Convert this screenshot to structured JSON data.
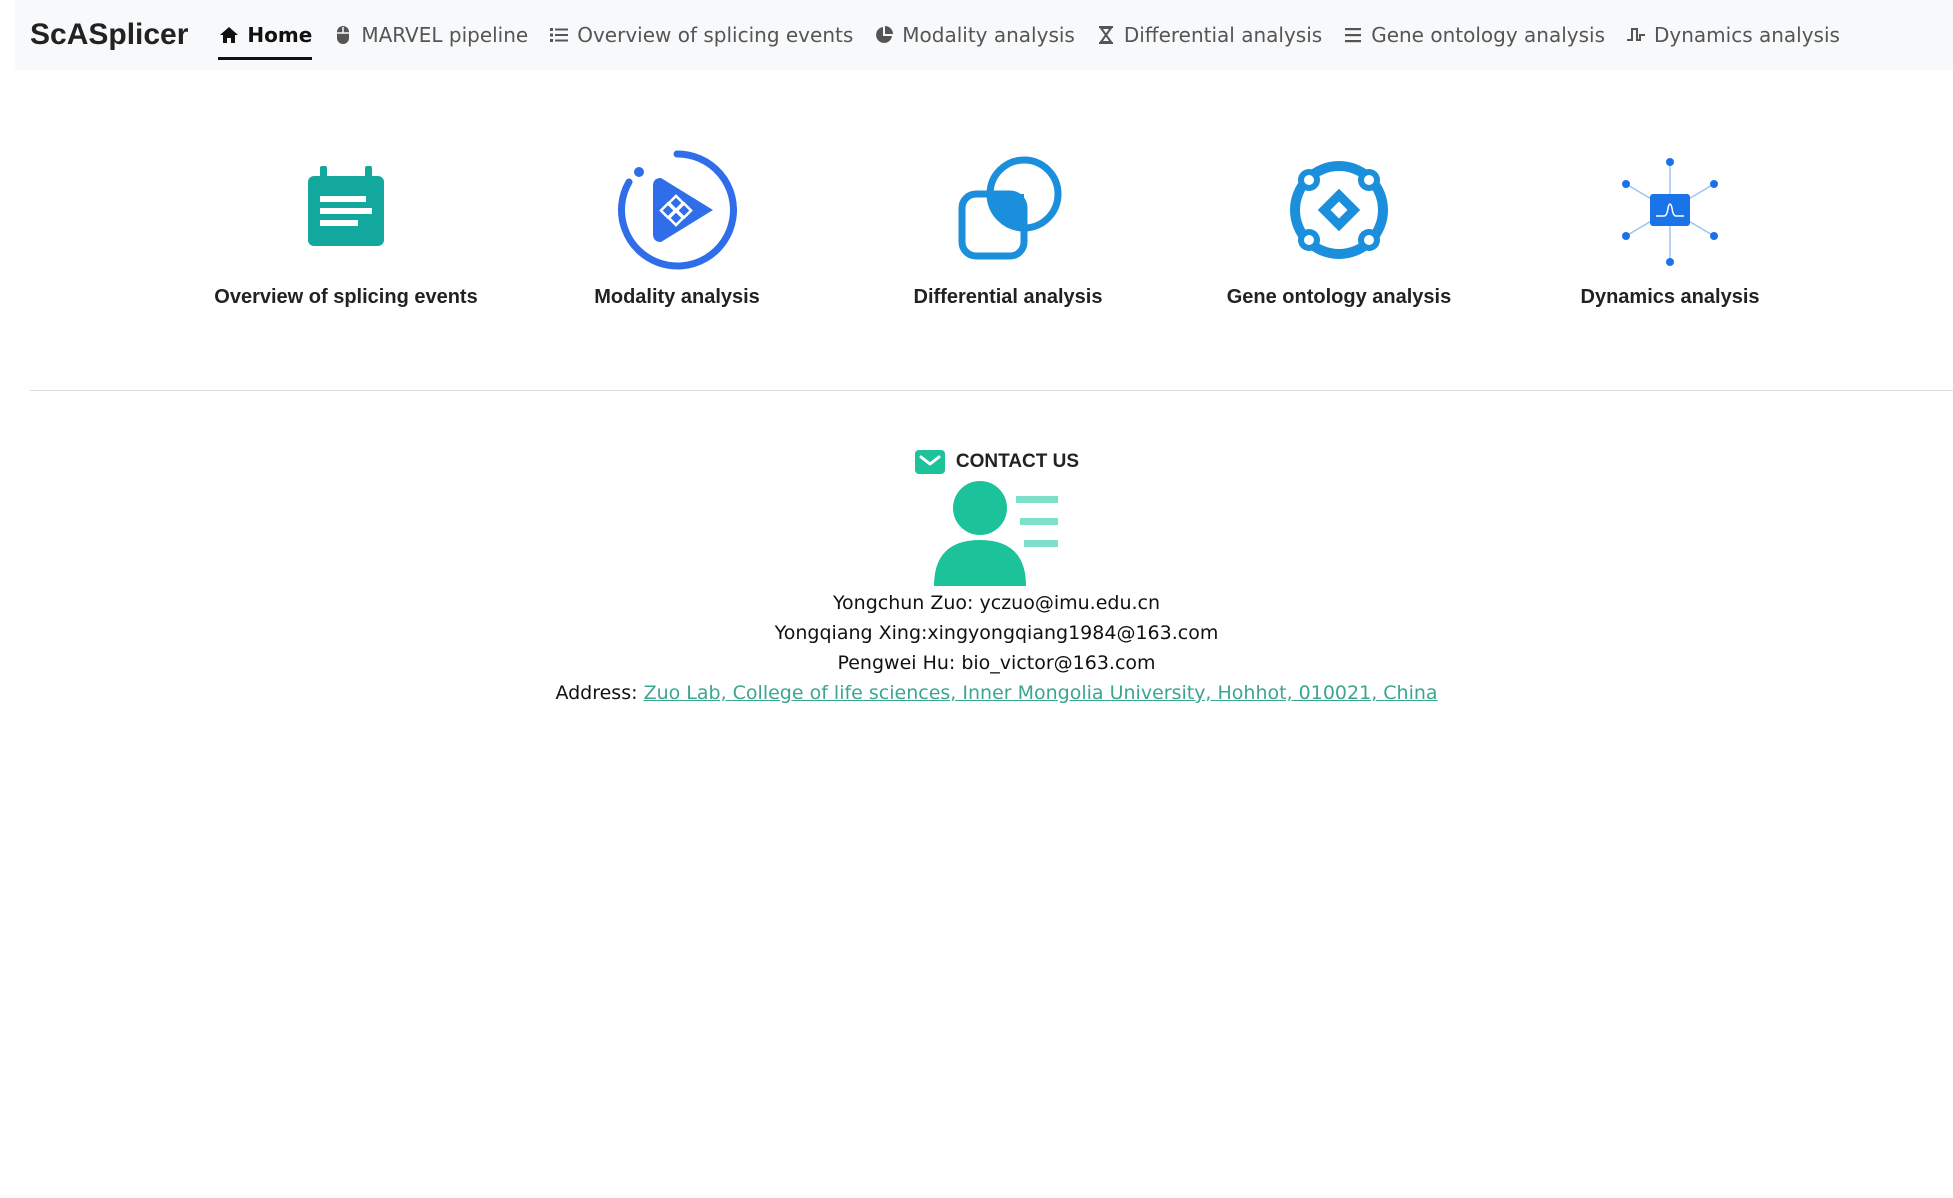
{
  "brand": "ScASplicer",
  "nav": {
    "items": [
      {
        "label": "Home",
        "icon": "home-icon",
        "active": true
      },
      {
        "label": "MARVEL pipeline",
        "icon": "mouse-icon"
      },
      {
        "label": "Overview of splicing events",
        "icon": "list-icon"
      },
      {
        "label": "Modality analysis",
        "icon": "pie-chart-icon"
      },
      {
        "label": "Differential analysis",
        "icon": "hourglass-icon"
      },
      {
        "label": "Gene ontology analysis",
        "icon": "bars-icon"
      },
      {
        "label": "Dynamics analysis",
        "icon": "pulse-icon"
      }
    ]
  },
  "features": [
    {
      "label": "Overview of splicing events",
      "icon": "notepad-icon",
      "color": "#12a89d"
    },
    {
      "label": "Modality analysis",
      "icon": "play-circle-icon",
      "color": "#2f6ee8"
    },
    {
      "label": "Differential analysis",
      "icon": "shapes-icon",
      "color": "#1b8fdb"
    },
    {
      "label": "Gene ontology analysis",
      "icon": "network-diamond-icon",
      "color": "#1b8fdb"
    },
    {
      "label": "Dynamics analysis",
      "icon": "node-graph-icon",
      "color": "#1a73e8"
    }
  ],
  "contact": {
    "heading": "CONTACT US",
    "people": [
      "Yongchun Zuo: yczuo@imu.edu.cn",
      "Yongqiang Xing:xingyongqiang1984@163.com",
      "Pengwei Hu: bio_victor@163.com"
    ],
    "address_label": "Address:",
    "address_link": "Zuo Lab, College of life sciences, Inner Mongolia University, Hohhot, 010021, China"
  },
  "colors": {
    "navbar_bg": "#f8f9fa",
    "contact_green": "#1cc39a",
    "link_green": "#3aa690"
  }
}
